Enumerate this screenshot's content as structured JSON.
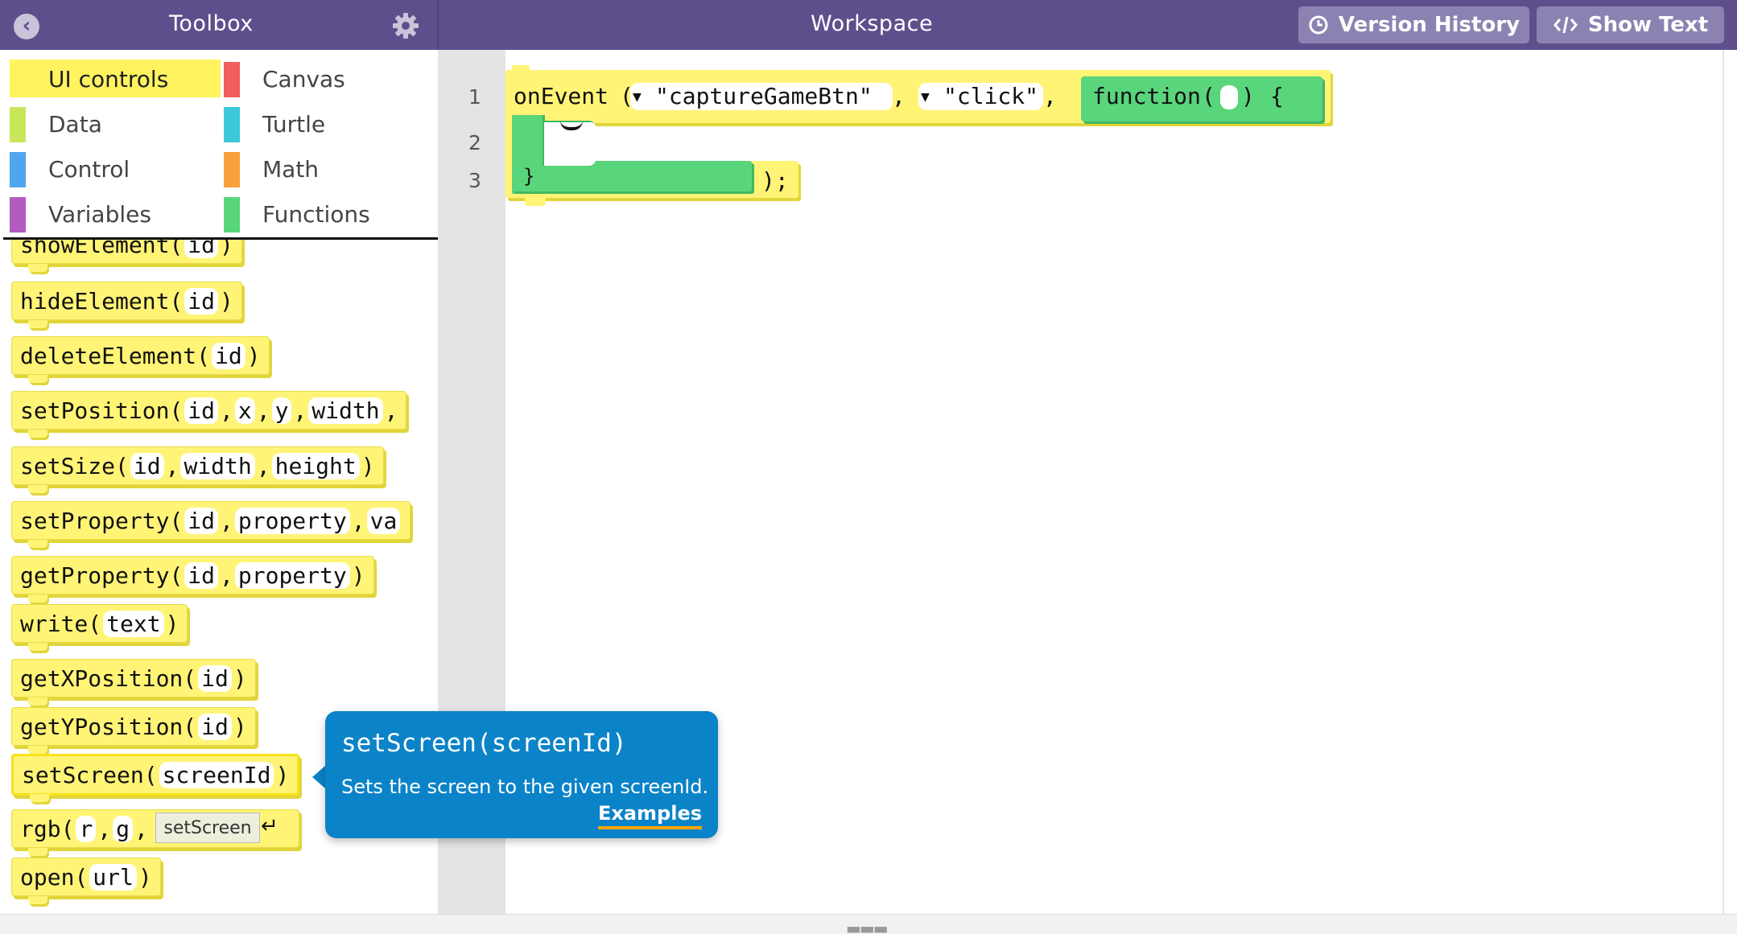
{
  "header": {
    "toolbox_title": "Toolbox",
    "workspace_title": "Workspace",
    "version_history_label": "Version History",
    "show_text_label": "Show Text"
  },
  "categories": [
    {
      "label": "UI controls",
      "color": "#fff45f",
      "selected": true
    },
    {
      "label": "Canvas",
      "color": "#f25c5c"
    },
    {
      "label": "Data",
      "color": "#c9e65b"
    },
    {
      "label": "Turtle",
      "color": "#3cc8d8"
    },
    {
      "label": "Control",
      "color": "#51a5ee"
    },
    {
      "label": "Math",
      "color": "#f8a03a"
    },
    {
      "label": "Variables",
      "color": "#b35bc1"
    },
    {
      "label": "Functions",
      "color": "#59d57c"
    }
  ],
  "palette": [
    {
      "name": "showElement",
      "args": [
        "id"
      ]
    },
    {
      "name": "hideElement",
      "args": [
        "id"
      ]
    },
    {
      "name": "deleteElement",
      "args": [
        "id"
      ]
    },
    {
      "name": "setPosition",
      "args": [
        "id",
        "x",
        "y",
        "width"
      ]
    },
    {
      "name": "setSize",
      "args": [
        "id",
        "width",
        "height"
      ]
    },
    {
      "name": "setProperty",
      "args": [
        "id",
        "property",
        "va"
      ]
    },
    {
      "name": "getProperty",
      "args": [
        "id",
        "property"
      ]
    },
    {
      "name": "write",
      "args": [
        "text"
      ]
    },
    {
      "name": "getXPosition",
      "args": [
        "id"
      ]
    },
    {
      "name": "getYPosition",
      "args": [
        "id"
      ]
    },
    {
      "name": "setScreen",
      "args": [
        "screenId"
      ]
    },
    {
      "name": "rgb",
      "args": [
        "r",
        "g"
      ]
    },
    {
      "name": "open",
      "args": [
        "url"
      ]
    }
  ],
  "line_numbers": [
    "1",
    "2",
    "3"
  ],
  "workspace_code": {
    "event_name": "onEvent",
    "element_id": "\"captureGameBtn\"",
    "event_type": "\"click\"",
    "function_keyword": "function",
    "close_brace": "}",
    "close_paren": ");"
  },
  "tooltip": {
    "title": "setScreen(screenId)",
    "description": "Sets the screen to the given screenId.",
    "link": "Examples"
  },
  "autocomplete": {
    "suggestion": "setScreen"
  }
}
